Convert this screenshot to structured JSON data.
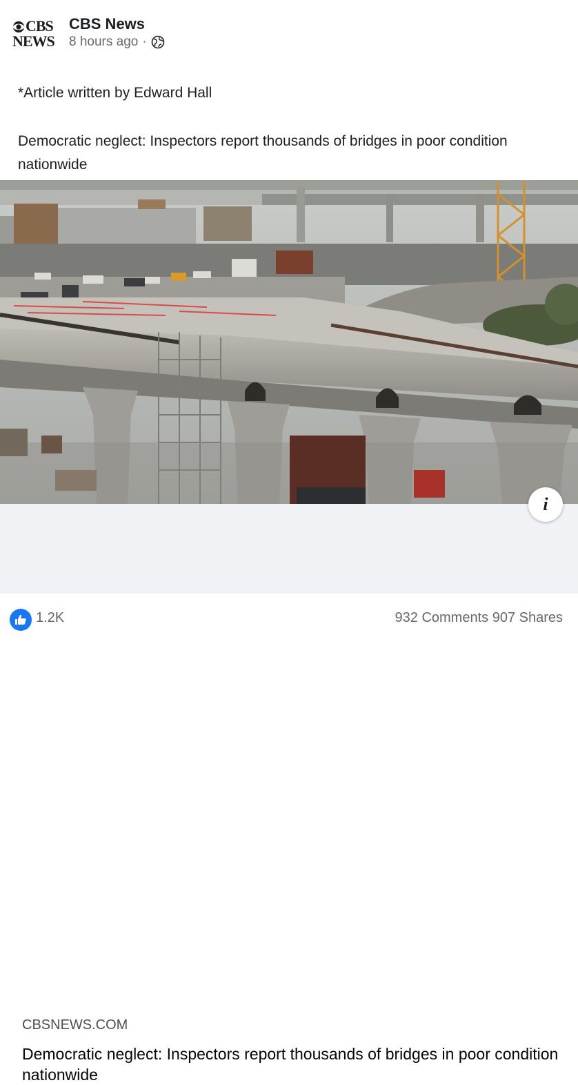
{
  "post": {
    "page_name": "CBS News",
    "logo_line1": "CBS",
    "logo_line2": "NEWS",
    "time": "8 hours ago",
    "separator": "·",
    "privacy_icon": "globe-icon",
    "text_line1": "*Article written by Edward Hall",
    "text_line2": "Democratic neglect: Inspectors report thousands of bridges in poor condition nationwide"
  },
  "link": {
    "domain": "CBSNEWS.COM",
    "title": "Democratic neglect: Inspectors report thousands of bridges in poor condition nationwide",
    "info_label": "i",
    "image_icon": "bridge-construction-photo"
  },
  "reactions": {
    "icon": "thumbs-up-icon",
    "likes": "1.2K",
    "comments": "932 Comments",
    "shares": "907 Shares"
  },
  "colors": {
    "brand_blue": "#1877f2",
    "link_bg": "#f0f2f5",
    "meta_gray": "#65676b"
  }
}
